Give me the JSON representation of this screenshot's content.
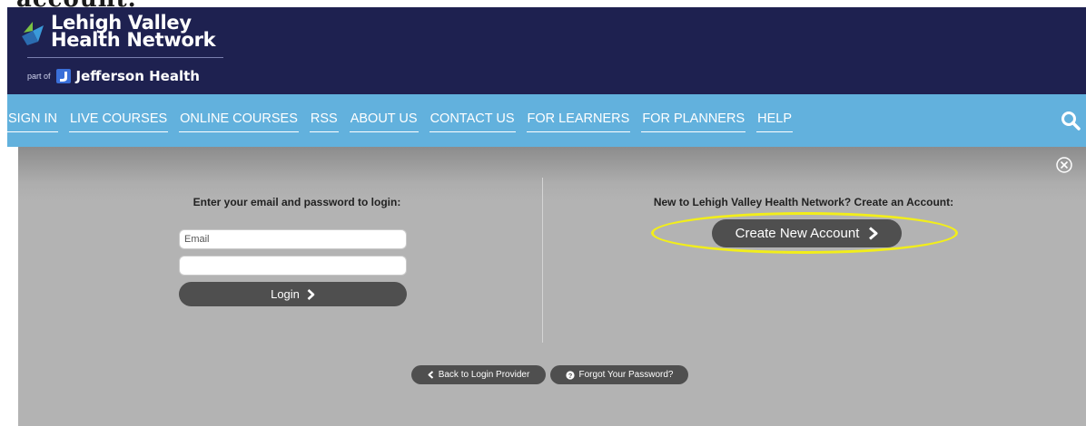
{
  "screenshot_caption_fragment": "account.",
  "brand": {
    "name_line1": "Lehigh Valley",
    "name_line2": "Health Network",
    "part_of_label": "part of",
    "parent_brand": "Jefferson Health",
    "colors": {
      "header_bg": "#1e2150",
      "nav_bg": "#62b1dd",
      "logo_green": "#7ac143",
      "logo_blue": "#3a9ad9",
      "jefferson_blue": "#3a6fd8"
    }
  },
  "nav": {
    "items": [
      {
        "label": "SIGN IN"
      },
      {
        "label": "LIVE COURSES"
      },
      {
        "label": "ONLINE COURSES"
      },
      {
        "label": "RSS"
      },
      {
        "label": "ABOUT US"
      },
      {
        "label": "CONTACT US"
      },
      {
        "label": "FOR LEARNERS"
      },
      {
        "label": "FOR PLANNERS"
      },
      {
        "label": "HELP"
      }
    ],
    "search_icon": "search-icon"
  },
  "modal": {
    "close_icon": "close-circle-icon",
    "login": {
      "title": "Enter your email and password to login:",
      "email_placeholder": "Email",
      "email_value": "",
      "password_placeholder": "",
      "button_label": "Login",
      "button_icon": "chevron-right-icon"
    },
    "new_account": {
      "title": "New to Lehigh Valley Health Network? Create an Account:",
      "button_label": "Create New Account",
      "button_icon": "chevron-right-icon",
      "highlight_color": "#f2ee1a"
    },
    "footer": {
      "back_label": "Back to Login Provider",
      "back_icon": "chevron-left-icon",
      "forgot_label": "Forgot Your Password?",
      "forgot_icon": "question-circle-icon"
    }
  }
}
